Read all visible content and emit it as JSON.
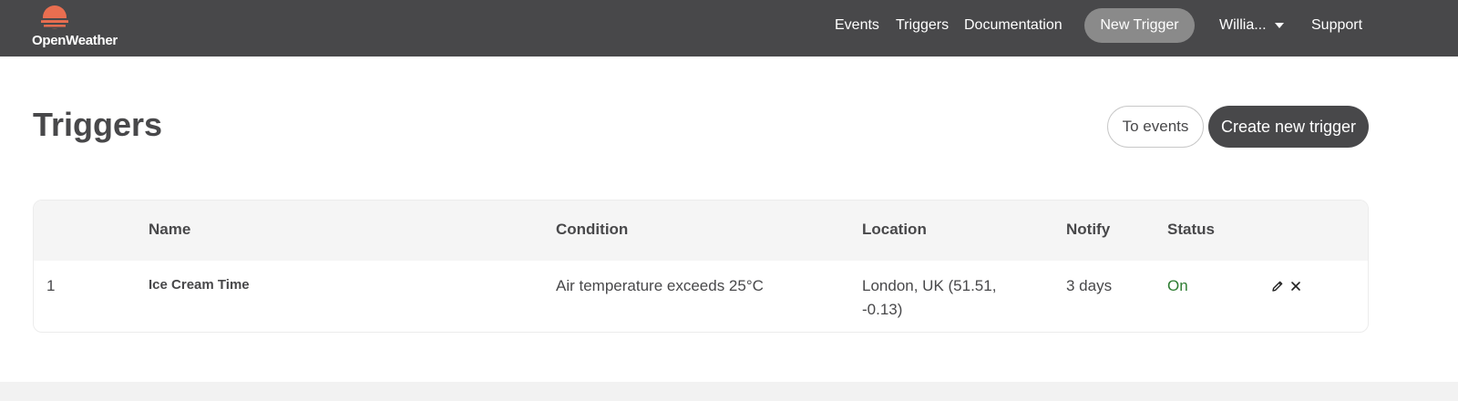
{
  "brand": {
    "name": "OpenWeather",
    "accent": "#e96e50"
  },
  "nav": {
    "events": "Events",
    "triggers": "Triggers",
    "documentation": "Documentation",
    "new_trigger": "New Trigger",
    "user": "Willia...",
    "support": "Support"
  },
  "page": {
    "title": "Triggers",
    "to_events": "To events",
    "create_new": "Create new trigger"
  },
  "table": {
    "headers": {
      "index": "",
      "name": "Name",
      "condition": "Condition",
      "location": "Location",
      "notify": "Notify",
      "status": "Status"
    },
    "rows": [
      {
        "index": "1",
        "name": "Ice Cream Time",
        "condition": "Air temperature exceeds 25°C",
        "location_line1": "London, UK (51.51,",
        "location_line2": "-0.13)",
        "notify": "3 days",
        "status": "On",
        "status_color": "#2e7d32",
        "actions": [
          "pencil-icon",
          "close-icon"
        ]
      }
    ]
  }
}
